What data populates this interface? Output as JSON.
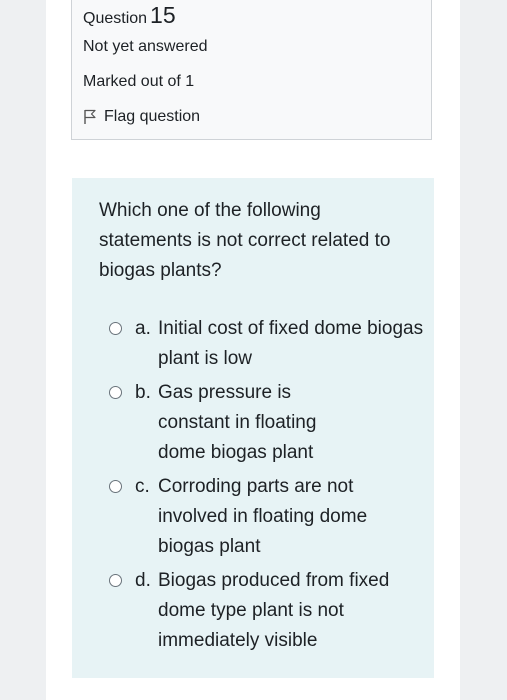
{
  "question": {
    "label": "Question",
    "number": "15",
    "state": "Not yet answered",
    "grade": "Marked out of 1",
    "flag_label": "Flag question",
    "flag_icon": "flag-outline-icon",
    "text": "Which one of the following statements is not correct related to biogas plants?",
    "options": [
      {
        "letter": "a.",
        "text": "Initial cost of fixed dome biogas plant is low"
      },
      {
        "letter": "b.",
        "text": "Gas pressure is constant in floating dome biogas plant"
      },
      {
        "letter": "c.",
        "text": "Corroding parts are not involved in floating dome biogas plant"
      },
      {
        "letter": "d.",
        "text": "Biogas produced from fixed dome type plant is not immediately visible"
      }
    ]
  },
  "colors": {
    "info_bg": "#f8f9fa",
    "content_bg": "#e7f3f5",
    "text": "#1d2125"
  }
}
